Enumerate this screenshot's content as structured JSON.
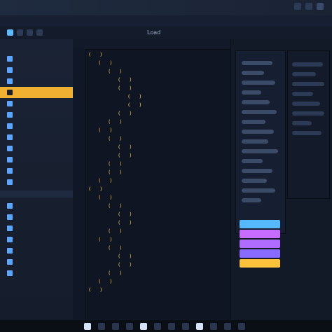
{
  "window": {
    "title": "",
    "menu": [
      "",
      "",
      "",
      "",
      ""
    ],
    "toolbar": {
      "label_1": "Load",
      "label_2": ""
    }
  },
  "sidebar": {
    "title": "",
    "items": [
      {
        "label": "",
        "color": "#5aa7ff",
        "active": false
      },
      {
        "label": "",
        "color": "#5aa7ff",
        "active": false
      },
      {
        "label": "",
        "color": "#5aa7ff",
        "active": false
      },
      {
        "label": "",
        "color": "#f0b132",
        "active": true
      },
      {
        "label": "",
        "color": "#5aa7ff",
        "active": false
      },
      {
        "label": "",
        "color": "#5aa7ff",
        "active": false
      },
      {
        "label": "",
        "color": "#5aa7ff",
        "active": false
      },
      {
        "label": "",
        "color": "#5aa7ff",
        "active": false
      },
      {
        "label": "",
        "color": "#5aa7ff",
        "active": false
      },
      {
        "label": "",
        "color": "#5aa7ff",
        "active": false
      },
      {
        "label": "",
        "color": "#5aa7ff",
        "active": false
      },
      {
        "label": "",
        "color": "#5aa7ff",
        "active": false
      }
    ],
    "section2_title": "",
    "section2_items": [
      {
        "label": "",
        "color": "#5aa7ff"
      },
      {
        "label": "",
        "color": "#5aa7ff"
      },
      {
        "label": "",
        "color": "#5aa7ff"
      },
      {
        "label": "",
        "color": "#5aa7ff"
      },
      {
        "label": "",
        "color": "#5aa7ff"
      },
      {
        "label": "",
        "color": "#5aa7ff"
      },
      {
        "label": "",
        "color": "#5aa7ff"
      }
    ]
  },
  "editor": {
    "tabs": [
      {
        "label": ""
      },
      {
        "label": ""
      }
    ],
    "lines": [
      {
        "indent": 0,
        "tokens": [
          {
            "t": "",
            "c": "pink"
          },
          {
            "t": "",
            "c": "yellow"
          }
        ]
      },
      {
        "indent": 1,
        "tokens": [
          {
            "t": "",
            "c": "white"
          },
          {
            "t": "",
            "c": "pink"
          }
        ]
      },
      {
        "indent": 2,
        "tokens": [
          {
            "t": "",
            "c": "pink"
          },
          {
            "t": "",
            "c": "white"
          }
        ]
      },
      {
        "indent": 3,
        "tokens": [
          {
            "t": "",
            "c": "yellow"
          },
          {
            "t": "",
            "c": "pink"
          }
        ]
      },
      {
        "indent": 3,
        "tokens": [
          {
            "t": "",
            "c": "white"
          },
          {
            "t": "",
            "c": "pink"
          }
        ]
      },
      {
        "indent": 4,
        "tokens": [
          {
            "t": "",
            "c": "pink"
          },
          {
            "t": "",
            "c": "white"
          }
        ]
      },
      {
        "indent": 4,
        "tokens": [
          {
            "t": "",
            "c": "white"
          },
          {
            "t": "",
            "c": "pink"
          }
        ]
      },
      {
        "indent": 3,
        "tokens": [
          {
            "t": "",
            "c": "pink"
          },
          {
            "t": "",
            "c": "yellow"
          }
        ]
      },
      {
        "indent": 2,
        "tokens": [
          {
            "t": "",
            "c": "white"
          },
          {
            "t": "",
            "c": "pink"
          }
        ]
      },
      {
        "indent": 1,
        "tokens": [
          {
            "t": "",
            "c": "pink"
          },
          {
            "t": "",
            "c": "white"
          }
        ]
      },
      {
        "indent": 2,
        "tokens": [
          {
            "t": "",
            "c": "pink"
          },
          {
            "t": "",
            "c": "white"
          }
        ]
      },
      {
        "indent": 3,
        "tokens": [
          {
            "t": "",
            "c": "white"
          },
          {
            "t": "",
            "c": "pink"
          }
        ]
      },
      {
        "indent": 3,
        "tokens": [
          {
            "t": "",
            "c": "pink"
          },
          {
            "t": "",
            "c": "white"
          }
        ]
      },
      {
        "indent": 2,
        "tokens": [
          {
            "t": "",
            "c": "pink"
          },
          {
            "t": "",
            "c": "yellow"
          }
        ]
      },
      {
        "indent": 2,
        "tokens": [
          {
            "t": "",
            "c": "white"
          },
          {
            "t": "",
            "c": "pink"
          }
        ]
      },
      {
        "indent": 1,
        "tokens": [
          {
            "t": "",
            "c": "pink"
          },
          {
            "t": "",
            "c": "white"
          }
        ]
      },
      {
        "indent": 0,
        "tokens": [
          {
            "t": "",
            "c": "pink"
          },
          {
            "t": "",
            "c": "yellow"
          }
        ]
      },
      {
        "indent": 1,
        "tokens": [
          {
            "t": "",
            "c": "white"
          },
          {
            "t": "",
            "c": "pink"
          }
        ]
      },
      {
        "indent": 2,
        "tokens": [
          {
            "t": "",
            "c": "pink"
          },
          {
            "t": "",
            "c": "white"
          }
        ]
      },
      {
        "indent": 3,
        "tokens": [
          {
            "t": "",
            "c": "white"
          },
          {
            "t": "",
            "c": "pink"
          }
        ]
      },
      {
        "indent": 3,
        "tokens": [
          {
            "t": "",
            "c": "pink"
          },
          {
            "t": "",
            "c": "white"
          }
        ]
      },
      {
        "indent": 2,
        "tokens": [
          {
            "t": "",
            "c": "pink"
          },
          {
            "t": "",
            "c": "yellow"
          }
        ]
      },
      {
        "indent": 1,
        "tokens": [
          {
            "t": "",
            "c": "white"
          },
          {
            "t": "",
            "c": "pink"
          }
        ]
      },
      {
        "indent": 2,
        "tokens": [
          {
            "t": "",
            "c": "pink"
          },
          {
            "t": "",
            "c": "white"
          }
        ]
      },
      {
        "indent": 3,
        "tokens": [
          {
            "t": "",
            "c": "white"
          },
          {
            "t": "",
            "c": "pink"
          }
        ]
      },
      {
        "indent": 3,
        "tokens": [
          {
            "t": "",
            "c": "pink"
          },
          {
            "t": "",
            "c": "white"
          }
        ]
      },
      {
        "indent": 2,
        "tokens": [
          {
            "t": "",
            "c": "pink"
          },
          {
            "t": "",
            "c": "yellow"
          }
        ]
      },
      {
        "indent": 1,
        "tokens": [
          {
            "t": "",
            "c": "white"
          },
          {
            "t": "",
            "c": "pink"
          }
        ]
      },
      {
        "indent": 0,
        "tokens": [
          {
            "t": "",
            "c": "pink"
          },
          {
            "t": "",
            "c": "white"
          }
        ]
      }
    ]
  },
  "right_panel": {
    "legend": [
      {
        "label": "",
        "color": "#56b8ff"
      },
      {
        "label": "",
        "color": "#c86bff"
      },
      {
        "label": "",
        "color": "#b06bff"
      },
      {
        "label": "",
        "color": "#8a6bff"
      },
      {
        "label": "",
        "color": "#ffc23a"
      }
    ]
  },
  "colors": {
    "accent_blue": "#5aa7ff",
    "accent_orange": "#f0b132",
    "code_pink": "#ff5fa2",
    "code_yellow": "#ffd24a"
  }
}
